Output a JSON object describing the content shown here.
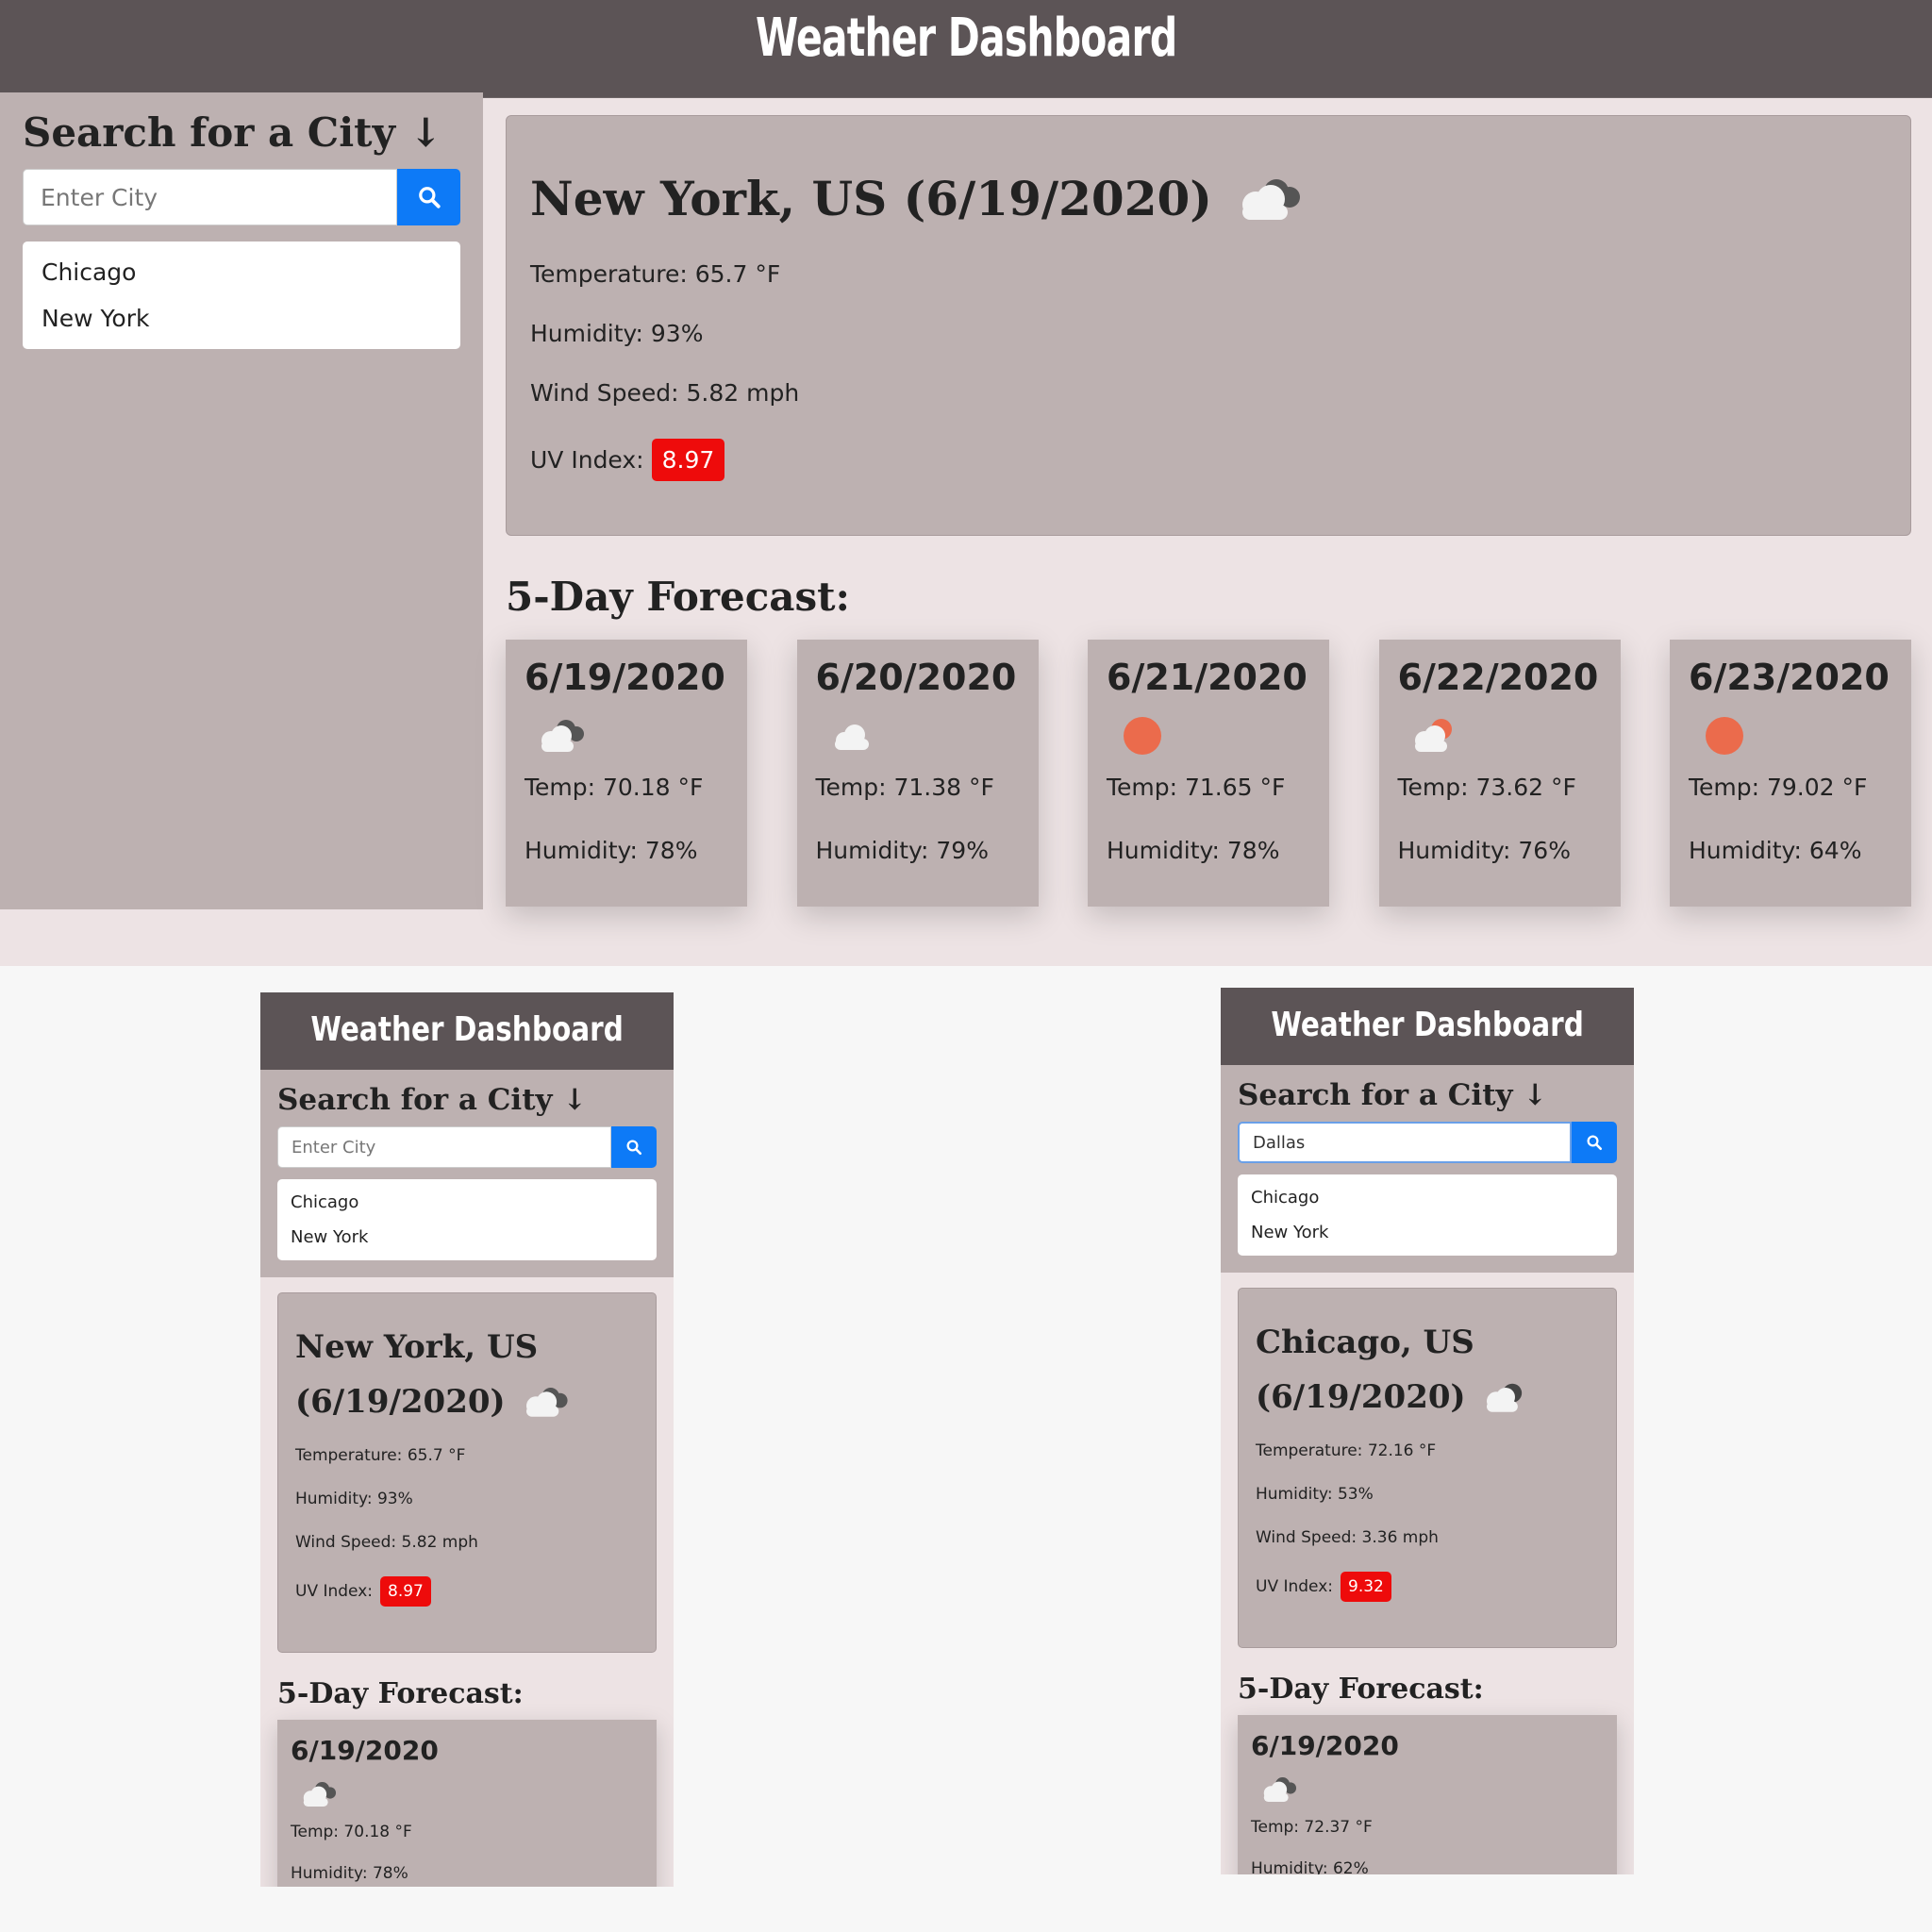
{
  "app_title": "Weather Dashboard",
  "search": {
    "heading": "Search for a City ↓",
    "placeholder": "Enter City",
    "button_icon": "search-icon"
  },
  "history": [
    "Chicago",
    "New York"
  ],
  "colors": {
    "header": "#5c5456",
    "panel": "#bdb1b1",
    "background": "#ede3e4",
    "search_button": "#0d7af7",
    "uv_badge": "#ee0b0b"
  },
  "desktop": {
    "current": {
      "title": "New York, US (6/19/2020)",
      "icon": "cloudy-icon",
      "temperature": "Temperature: 65.7 °F",
      "humidity": "Humidity: 93%",
      "wind": "Wind Speed: 5.82 mph",
      "uv_label": "UV Index:",
      "uv_value": "8.97"
    },
    "forecast_heading": "5-Day Forecast:",
    "forecast": [
      {
        "date": "6/19/2020",
        "icon": "broken-clouds-icon",
        "temp": "Temp: 70.18 °F",
        "humidity": "Humidity: 78%"
      },
      {
        "date": "6/20/2020",
        "icon": "cloud-icon",
        "temp": "Temp: 71.38 °F",
        "humidity": "Humidity: 79%"
      },
      {
        "date": "6/21/2020",
        "icon": "sun-icon",
        "temp": "Temp: 71.65 °F",
        "humidity": "Humidity: 78%"
      },
      {
        "date": "6/22/2020",
        "icon": "partly-sunny-icon",
        "temp": "Temp: 73.62 °F",
        "humidity": "Humidity: 76%"
      },
      {
        "date": "6/23/2020",
        "icon": "sun-icon",
        "temp": "Temp: 79.02 °F",
        "humidity": "Humidity: 64%"
      }
    ]
  },
  "mobile_left": {
    "search_value": "",
    "current": {
      "title_line1": "New York, US",
      "title_line2": "(6/19/2020)",
      "temperature": "Temperature: 65.7 °F",
      "humidity": "Humidity: 93%",
      "wind": "Wind Speed: 5.82 mph",
      "uv_label": "UV Index:",
      "uv_value": "8.97"
    },
    "forecast_heading": "5-Day Forecast:",
    "forecast_first": {
      "date": "6/19/2020",
      "temp": "Temp: 70.18 °F",
      "humidity": "Humidity: 78%"
    }
  },
  "mobile_right": {
    "search_value": "Dallas",
    "current": {
      "title_line1": "Chicago, US",
      "title_line2": "(6/19/2020)",
      "temperature": "Temperature: 72.16 °F",
      "humidity": "Humidity: 53%",
      "wind": "Wind Speed: 3.36 mph",
      "uv_label": "UV Index:",
      "uv_value": "9.32"
    },
    "forecast_heading": "5-Day Forecast:",
    "forecast_first": {
      "date": "6/19/2020",
      "temp": "Temp: 72.37 °F",
      "humidity": "Humidity: 62%"
    }
  }
}
